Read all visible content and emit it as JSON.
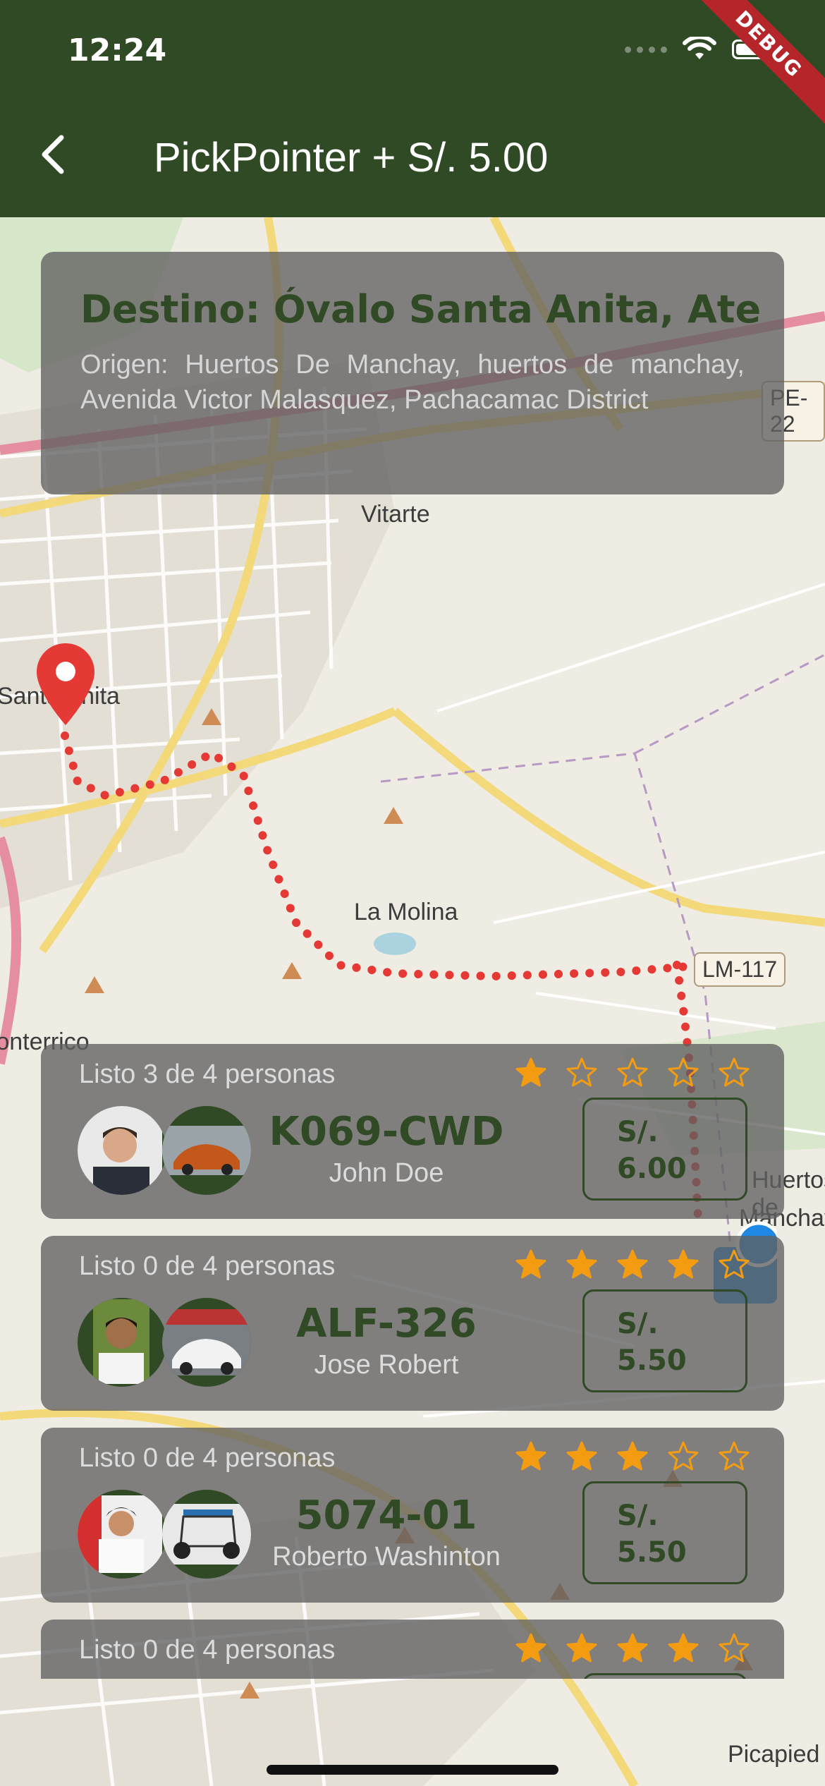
{
  "status_bar": {
    "time": "12:24",
    "debug_label": "DEBUG"
  },
  "app_bar": {
    "title": "PickPointer + S/. 5.00"
  },
  "map": {
    "labels": [
      "Vitarte",
      "La Molina",
      "Santa Anita",
      "Monterrico",
      "Huertos de",
      "Manchay",
      "Picapied"
    ],
    "road_shields": [
      "LM-117",
      "PE-22"
    ]
  },
  "destination": {
    "title": "Destino: Óvalo Santa Anita, Ate",
    "origin": "Origen: Huertos De Manchay, huertos de manchay, Avenida Victor Malasquez, Pachacamac District"
  },
  "drivers": [
    {
      "seats": "Listo 3 de 4 personas",
      "rating": 1,
      "plate": "K069-CWD",
      "name": "John Doe",
      "price_currency": "S/.",
      "price_value": "6.00"
    },
    {
      "seats": "Listo 0 de 4 personas",
      "rating": 4,
      "plate": "ALF-326",
      "name": "Jose Robert",
      "price_currency": "S/.",
      "price_value": "5.50"
    },
    {
      "seats": "Listo 0 de 4 personas",
      "rating": 3,
      "plate": "5074-01",
      "name": "Roberto Washinton",
      "price_currency": "S/.",
      "price_value": "5.50"
    },
    {
      "seats": "Listo 0 de 4 personas",
      "rating": 4,
      "plate": "",
      "name": "",
      "price_currency": "",
      "price_value": ""
    }
  ],
  "colors": {
    "primary": "#2f4a25",
    "route": "#e53935",
    "star": "#f39c12"
  },
  "icons": {
    "back": "chevron-left-icon",
    "pin": "location-pin-icon",
    "star": "star-icon"
  }
}
